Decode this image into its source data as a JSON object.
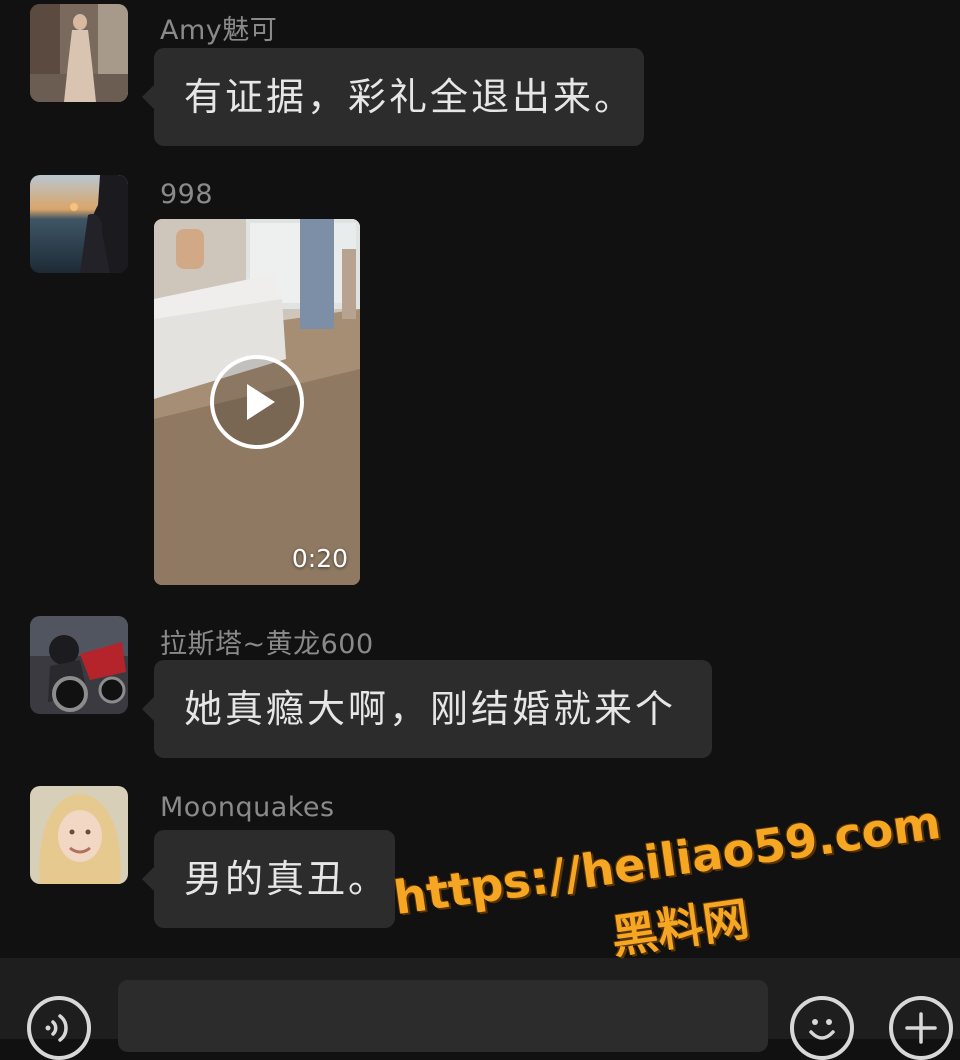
{
  "messages": [
    {
      "sender": "Amy魅可",
      "avatar_icon": "avatar-fashion-photo",
      "text": "有证据，彩礼全退出来。"
    },
    {
      "sender": "998",
      "avatar_icon": "avatar-sunset-photo",
      "video": {
        "duration": "0:20",
        "play_icon": "play-icon"
      }
    },
    {
      "sender": "拉斯塔~黄龙600",
      "avatar_icon": "avatar-motorcycle-photo",
      "text": "她真瘾大啊，刚结婚就来个"
    },
    {
      "sender": "Moonquakes",
      "avatar_icon": "avatar-portrait-photo",
      "text": "男的真丑。"
    }
  ],
  "watermark": {
    "url": "https://heiliao59.com",
    "label": "黑料网"
  },
  "input_bar": {
    "voice_icon": "voice-icon",
    "text_value": "",
    "emoji_icon": "emoji-icon",
    "plus_icon": "plus-icon"
  },
  "colors": {
    "background": "#111111",
    "bubble": "#2c2c2c",
    "text": "#e6e6e6",
    "sender_name": "#8a8a8a",
    "watermark": "#f5a623"
  }
}
